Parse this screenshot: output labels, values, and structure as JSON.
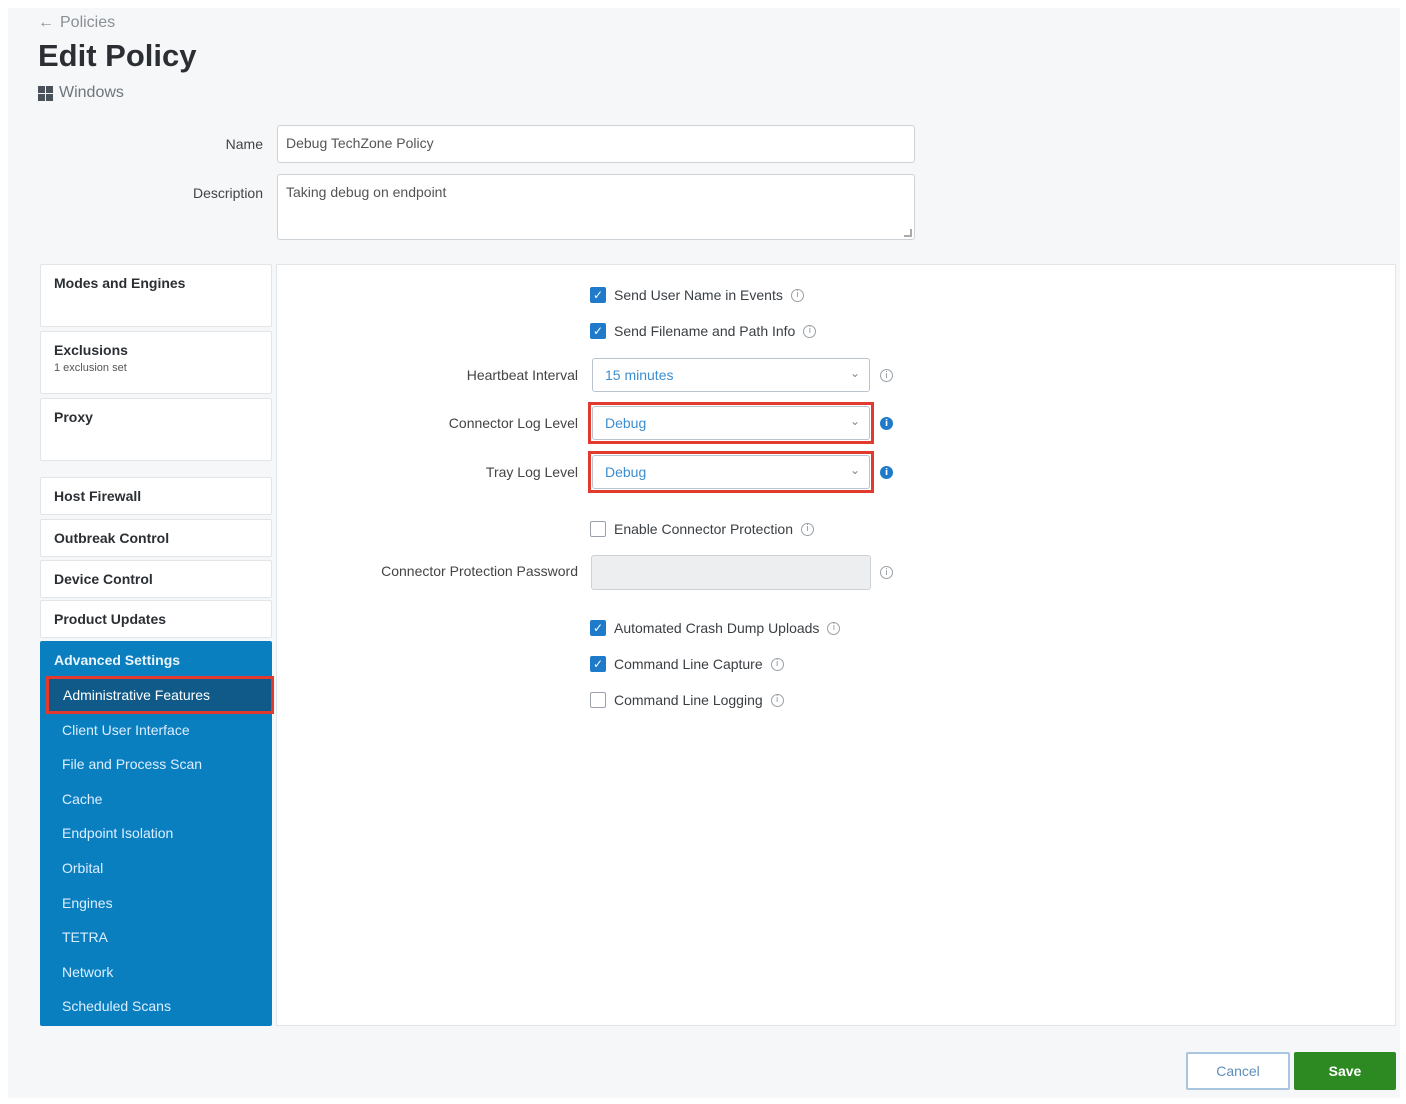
{
  "breadcrumb": {
    "arrow": "←",
    "label": "Policies"
  },
  "title": "Edit Policy",
  "os": {
    "icon": "windows-icon",
    "label": "Windows"
  },
  "form": {
    "name_label": "Name",
    "name_value": "Debug TechZone Policy",
    "description_label": "Description",
    "description_value": "Taking debug on endpoint"
  },
  "nav": {
    "cards": [
      {
        "label": "Modes and Engines",
        "sub": ""
      },
      {
        "label": "Exclusions",
        "sub": "1 exclusion set"
      },
      {
        "label": "Proxy",
        "sub": ""
      },
      {
        "label": "Host Firewall",
        "sub": ""
      },
      {
        "label": "Outbreak Control",
        "sub": ""
      },
      {
        "label": "Device Control",
        "sub": ""
      },
      {
        "label": "Product Updates",
        "sub": ""
      }
    ],
    "advanced_title": "Advanced Settings",
    "advanced_items": [
      "Administrative Features",
      "Client User Interface",
      "File and Process Scan",
      "Cache",
      "Endpoint Isolation",
      "Orbital",
      "Engines",
      "TETRA",
      "Network",
      "Scheduled Scans"
    ],
    "active_item": "Administrative Features"
  },
  "settings": {
    "send_user_name": {
      "label": "Send User Name in Events",
      "checked": true
    },
    "send_filename": {
      "label": "Send Filename and Path Info",
      "checked": true
    },
    "heartbeat": {
      "label": "Heartbeat Interval",
      "value": "15 minutes"
    },
    "connector_log": {
      "label": "Connector Log Level",
      "value": "Debug"
    },
    "tray_log": {
      "label": "Tray Log Level",
      "value": "Debug"
    },
    "enable_protection": {
      "label": "Enable Connector Protection",
      "checked": false
    },
    "protection_password": {
      "label": "Connector Protection Password",
      "value": ""
    },
    "crash_dump": {
      "label": "Automated Crash Dump Uploads",
      "checked": true
    },
    "cmd_capture": {
      "label": "Command Line Capture",
      "checked": true
    },
    "cmd_logging": {
      "label": "Command Line Logging",
      "checked": false
    }
  },
  "icons": {
    "checkmark": "✓",
    "chevron": "⌄",
    "info": "i"
  },
  "colors": {
    "accent": "#0a7fc0",
    "active_nav": "#0f5a89",
    "highlight": "#e23a2e",
    "save": "#2d8a23",
    "checkbox": "#1f7bc9"
  },
  "buttons": {
    "cancel": "Cancel",
    "save": "Save"
  }
}
